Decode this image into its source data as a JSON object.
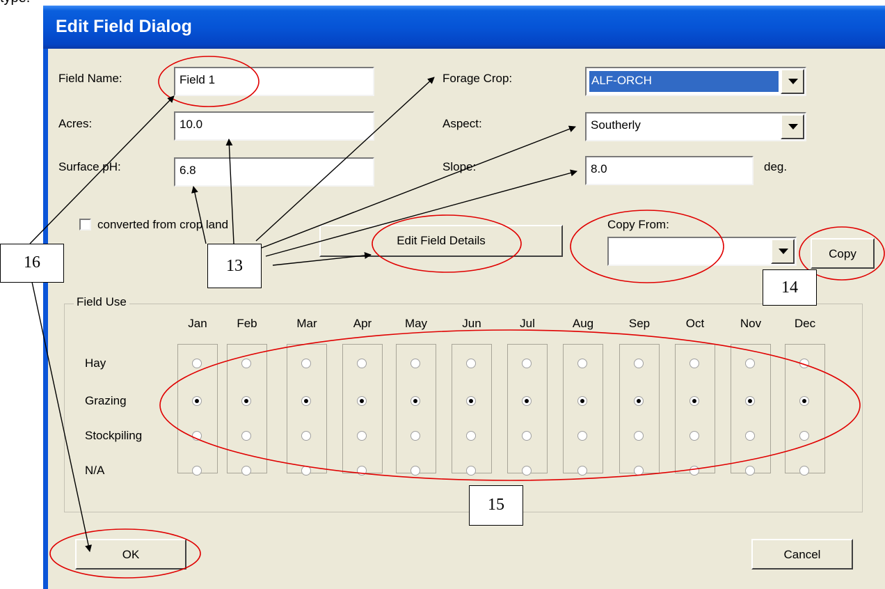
{
  "doc_text": "type.",
  "dialog": {
    "title": "Edit Field Dialog"
  },
  "form": {
    "field_name": {
      "label": "Field Name:",
      "value": "Field 1"
    },
    "acres": {
      "label": "Acres:",
      "value": "10.0"
    },
    "surface_ph": {
      "label": "Surface pH:",
      "value": "6.8"
    },
    "forage_crop": {
      "label": "Forage Crop:",
      "value": "ALF-ORCH"
    },
    "aspect": {
      "label": "Aspect:",
      "value": "Southerly"
    },
    "slope": {
      "label": "Slope:",
      "value": "8.0",
      "unit": "deg."
    },
    "converted_checkbox": {
      "label": "converted from crop land",
      "checked": false
    },
    "edit_details_button": "Edit Field Details",
    "copy_from": {
      "label": "Copy From:",
      "value": ""
    },
    "copy_button": "Copy"
  },
  "field_use": {
    "title": "Field Use",
    "months": [
      "Jan",
      "Feb",
      "Mar",
      "Apr",
      "May",
      "Jun",
      "Jul",
      "Aug",
      "Sep",
      "Oct",
      "Nov",
      "Dec"
    ],
    "rows": [
      "Hay",
      "Grazing",
      "Stockpiling",
      "N/A"
    ],
    "selected_row": "Grazing"
  },
  "buttons": {
    "ok": "OK",
    "cancel": "Cancel"
  },
  "annotations": {
    "a13": "13",
    "a14": "14",
    "a15": "15",
    "a16": "16"
  },
  "colors": {
    "titlebar": "#0654d6",
    "dialog_bg": "#ece9d8",
    "selection": "#316ac5",
    "annotation_ellipse": "#e00000"
  }
}
